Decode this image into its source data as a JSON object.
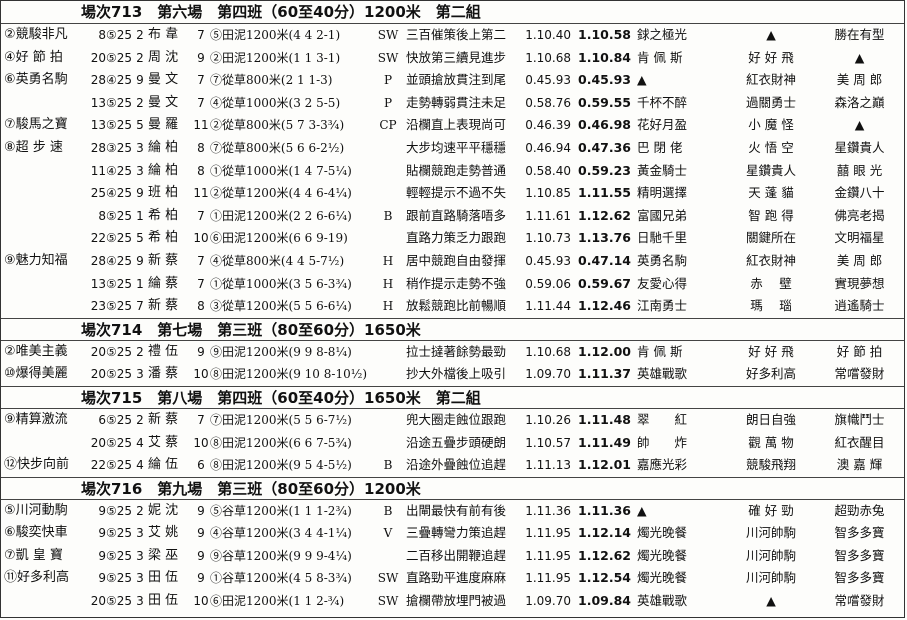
{
  "races": [
    {
      "header": "場次713　第六場　第四班（60至40分）1200米　第二組",
      "rows": [
        {
          "horse": "②競駿非凡",
          "date": "8⑤25",
          "dr": "2",
          "jockey": "布 韋",
          "wt": "7",
          "details": "⑤田泥1200米(4 4 2-1)",
          "gear": "SW",
          "comment": "三百催策後上第二",
          "t1": "1.10.40",
          "t2": "1.10.58",
          "p1": "銶之極光",
          "p2": "▲",
          "p3": "勝在有型"
        },
        {
          "horse": "④好 節 拍",
          "date": "20⑤25",
          "dr": "2",
          "jockey": "周 沈",
          "wt": "9",
          "details": "②田泥1200米(1 1 3-1)",
          "gear": "SW",
          "comment": "快放第三續見進步",
          "t1": "1.10.68",
          "t2": "1.10.84",
          "p1": "肯 佩 斯",
          "p2": "好 好 飛",
          "p3": "▲"
        },
        {
          "horse": "⑥英勇名駒",
          "date": "28④25",
          "dr": "9",
          "jockey": "曼 文",
          "wt": "7",
          "details": "⑦從草800米(2 1 1-3)",
          "gear": "P",
          "comment": "並頭搶放貫注到尾",
          "t1": "0.45.93",
          "t2": "0.45.93",
          "p1": "▲",
          "p2": "紅衣財神",
          "p3": "美 周 郎"
        },
        {
          "horse": "",
          "date": "13⑤25",
          "dr": "2",
          "jockey": "曼 文",
          "wt": "7",
          "details": "④從草1000米(3 2 5-5)",
          "gear": "P",
          "comment": "走勢轉弱貫注未足",
          "t1": "0.58.76",
          "t2": "0.59.55",
          "p1": "千杯不醉",
          "p2": "過關勇士",
          "p3": "森洛之巔"
        },
        {
          "horse": "⑦駿馬之寶",
          "date": "13⑤25",
          "dr": "5",
          "jockey": "曼 羅",
          "wt": "11",
          "details": "②從草800米(5 7 3-3¾)",
          "gear": "CP",
          "comment": "沿欄直上表現尚可",
          "t1": "0.46.39",
          "t2": "0.46.98",
          "p1": "花好月盈",
          "p2": "小 魔 怪",
          "p3": "▲"
        },
        {
          "horse": "⑧超 步 速",
          "date": "28③25",
          "dr": "3",
          "jockey": "綸 柏",
          "wt": "8",
          "details": "⑦從草800米(5 6 6-2½)",
          "gear": "",
          "comment": "大步均速平平穩穩",
          "t1": "0.46.94",
          "t2": "0.47.36",
          "p1": "巴 閉 佬",
          "p2": "火 悟 空",
          "p3": "星鑽貴人"
        },
        {
          "horse": "",
          "date": "11④25",
          "dr": "3",
          "jockey": "綸 柏",
          "wt": "8",
          "details": "①從草1000米(1 4 7-5¼)",
          "gear": "",
          "comment": "貼欄競跑走勢普通",
          "t1": "0.58.40",
          "t2": "0.59.23",
          "p1": "黃金騎士",
          "p2": "星鑽貴人",
          "p3": "囍 眼 光"
        },
        {
          "horse": "",
          "date": "25④25",
          "dr": "9",
          "jockey": "班 柏",
          "wt": "11",
          "details": "②從草1200米(4 4 6-4¼)",
          "gear": "",
          "comment": "輕輕提示不過不失",
          "t1": "1.10.85",
          "t2": "1.11.55",
          "p1": "精明選擇",
          "p2": "天 蓬 貓",
          "p3": "金鑽八十"
        },
        {
          "horse": "",
          "date": "8⑤25",
          "dr": "1",
          "jockey": "希 柏",
          "wt": "7",
          "details": "①田泥1200米(2 2 6-6¼)",
          "gear": "B",
          "comment": "跟前直路騎落唔多",
          "t1": "1.11.61",
          "t2": "1.12.62",
          "p1": "富國兄弟",
          "p2": "智 跑 得",
          "p3": "佛亮老揭"
        },
        {
          "horse": "",
          "date": "22⑤25",
          "dr": "5",
          "jockey": "希 柏",
          "wt": "10",
          "details": "⑥田泥1200米(6 6 9-19)",
          "gear": "",
          "comment": "直路力策乏力跟跑",
          "t1": "1.10.73",
          "t2": "1.13.76",
          "p1": "日馳千里",
          "p2": "關鍵所在",
          "p3": "文明福星"
        },
        {
          "horse": "⑨魅力知福",
          "date": "28④25",
          "dr": "9",
          "jockey": "新 蔡",
          "wt": "7",
          "details": "④從草800米(4 4 5-7½)",
          "gear": "H",
          "comment": "居中競跑自由發揮",
          "t1": "0.45.93",
          "t2": "0.47.14",
          "p1": "英勇名駒",
          "p2": "紅衣財神",
          "p3": "美 周 郎"
        },
        {
          "horse": "",
          "date": "13⑤25",
          "dr": "1",
          "jockey": "綸 蔡",
          "wt": "7",
          "details": "①從草1000米(3 5 6-3¾)",
          "gear": "H",
          "comment": "稍作提示走勢不強",
          "t1": "0.59.06",
          "t2": "0.59.67",
          "p1": "友愛心得",
          "p2": "赤　 壁",
          "p3": "實現夢想"
        },
        {
          "horse": "",
          "date": "23⑤25",
          "dr": "7",
          "jockey": "新 蔡",
          "wt": "8",
          "details": "③從草1200米(5 5 6-6¼)",
          "gear": "H",
          "comment": "放鬆競跑比前暢順",
          "t1": "1.11.44",
          "t2": "1.12.46",
          "p1": "江南勇士",
          "p2": "瑪　 瑙",
          "p3": "逍遙騎士"
        }
      ]
    },
    {
      "header": "場次714　第七場　第三班（80至60分）1650米",
      "rows": [
        {
          "horse": "②唯美主義",
          "date": "20⑤25",
          "dr": "2",
          "jockey": "禮 伍",
          "wt": "9",
          "details": "⑨田泥1200米(9 9 8-8¼)",
          "gear": "",
          "comment": "拉士撻著餘勢最勁",
          "t1": "1.10.68",
          "t2": "1.12.00",
          "p1": "肯 佩 斯",
          "p2": "好 好 飛",
          "p3": "好 節 拍"
        },
        {
          "horse": "⑩爆得美麗",
          "date": "20⑤25",
          "dr": "3",
          "jockey": "潘 蔡",
          "wt": "10",
          "details": "⑧田泥1200米(9 10 8-10½)",
          "gear": "",
          "comment": "抄大外檔後上吸引",
          "t1": "1.09.70",
          "t2": "1.11.37",
          "p1": "英雄戰歌",
          "p2": "好多利高",
          "p3": "常嚐發財"
        }
      ]
    },
    {
      "header": "場次715　第八場　第四班（60至40分）1650米　第二組",
      "rows": [
        {
          "horse": "⑨精算激流",
          "date": "6⑤25",
          "dr": "2",
          "jockey": "新 蔡",
          "wt": "7",
          "details": "⑦田泥1200米(5 5 6-7½)",
          "gear": "",
          "comment": "兜大圈走蝕位跟跑",
          "t1": "1.10.26",
          "t2": "1.11.48",
          "p1": "翠　　紅",
          "p2": "朗日自強",
          "p3": "旗幟鬥士"
        },
        {
          "horse": "",
          "date": "20⑤25",
          "dr": "4",
          "jockey": "艾 蔡",
          "wt": "10",
          "details": "⑧田泥1200米(6 6 7-5¾)",
          "gear": "",
          "comment": "沿途五疊步頭硬朗",
          "t1": "1.10.57",
          "t2": "1.11.49",
          "p1": "帥　　炸",
          "p2": "觀 萬 物",
          "p3": "紅衣醒目"
        },
        {
          "horse": "⑫快步向前",
          "date": "22⑤25",
          "dr": "4",
          "jockey": "綸 伍",
          "wt": "6",
          "details": "⑧田泥1200米(9 5 4-5½)",
          "gear": "B",
          "comment": "沿途外疊蝕位追趕",
          "t1": "1.11.13",
          "t2": "1.12.01",
          "p1": "嘉應光彩",
          "p2": "競駿飛翔",
          "p3": "澳 嘉 輝"
        }
      ]
    },
    {
      "header": "場次716　第九場　第三班（80至60分）1200米",
      "rows": [
        {
          "horse": "⑤川河動駒",
          "date": "9⑤25",
          "dr": "2",
          "jockey": "妮 沈",
          "wt": "9",
          "details": "⑤谷草1200米(1 1 1-2¾)",
          "gear": "B",
          "comment": "出閘最快有前有後",
          "t1": "1.11.36",
          "t2": "1.11.36",
          "p1": "▲",
          "p2": "確 好 勁",
          "p3": "超勁赤兔"
        },
        {
          "horse": "⑥駿奕快車",
          "date": "9⑤25",
          "dr": "3",
          "jockey": "艾 姚",
          "wt": "9",
          "details": "④谷草1200米(3 4 4-1¼)",
          "gear": "V",
          "comment": "三疊轉彎力策追趕",
          "t1": "1.11.95",
          "t2": "1.12.14",
          "p1": "燭光晚餐",
          "p2": "川河帥駒",
          "p3": "智多多寶"
        },
        {
          "horse": "⑦凱 皇 寶",
          "date": "9⑤25",
          "dr": "3",
          "jockey": "梁 巫",
          "wt": "9",
          "details": "⑨谷草1200米(9 9 9-4¼)",
          "gear": "",
          "comment": "二百移出開鞭追趕",
          "t1": "1.11.95",
          "t2": "1.12.62",
          "p1": "燭光晚餐",
          "p2": "川河帥駒",
          "p3": "智多多寶"
        },
        {
          "horse": "⑪好多利高",
          "date": "9⑤25",
          "dr": "3",
          "jockey": "田 伍",
          "wt": "9",
          "details": "①谷草1200米(4 5 8-3¾)",
          "gear": "SW",
          "comment": "直路勁平進度麻麻",
          "t1": "1.11.95",
          "t2": "1.12.54",
          "p1": "燭光晚餐",
          "p2": "川河帥駒",
          "p3": "智多多寶"
        },
        {
          "horse": "",
          "date": "20⑤25",
          "dr": "3",
          "jockey": "田 伍",
          "wt": "10",
          "details": "⑥田泥1200米(1 1 2-¾)",
          "gear": "SW",
          "comment": "搶欄帶放埋門被過",
          "t1": "1.09.70",
          "t2": "1.09.84",
          "p1": "英雄戰歌",
          "p2": "▲",
          "p3": "常嚐發財"
        }
      ]
    }
  ]
}
